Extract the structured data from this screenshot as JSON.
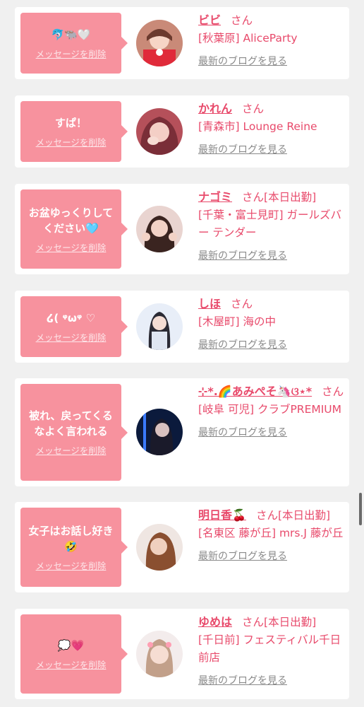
{
  "delete_label": "メッセージを削除",
  "blog_label": "最新のブログを見る",
  "san": "さん",
  "cards": [
    {
      "message": "🐬🐃🤍",
      "name": "ビビ",
      "suffix": "",
      "shop": "[秋葉原] AliceParty"
    },
    {
      "message": "すぱ！",
      "name": "かれん",
      "suffix": "",
      "shop": "[青森市] Lounge Reine"
    },
    {
      "message": "お盆ゆっくりしてください🩵",
      "name": "ナゴミ",
      "suffix": "[本日出勤]",
      "shop": "[千葉・富士見町] ガールズバー テンダー"
    },
    {
      "message": "໒( ᵠωᵠ ♡",
      "name": "しほ",
      "suffix": "",
      "shop": "[木屋町] 海の中"
    },
    {
      "message": "被れ、戻ってくるなよく言われる",
      "name": "⊹*.🌈あみぺそ🦄ଓ⋆*",
      "suffix": "",
      "shop": "[岐阜 可児] クラブPREMIUM"
    },
    {
      "message": "女子はお話し好き🤣",
      "name": "明日香🍒",
      "suffix": "[本日出勤]",
      "shop": "[名東区 藤が丘] mrs.J 藤が丘"
    },
    {
      "message": "💭💗",
      "name": "ゆめは",
      "suffix": "[本日出勤]",
      "shop": "[千日前] フェスティバル千日前店"
    }
  ],
  "colors": {
    "accent": "#e84a6b",
    "bubble": "#f7929e",
    "background": "#f0f0f0"
  }
}
